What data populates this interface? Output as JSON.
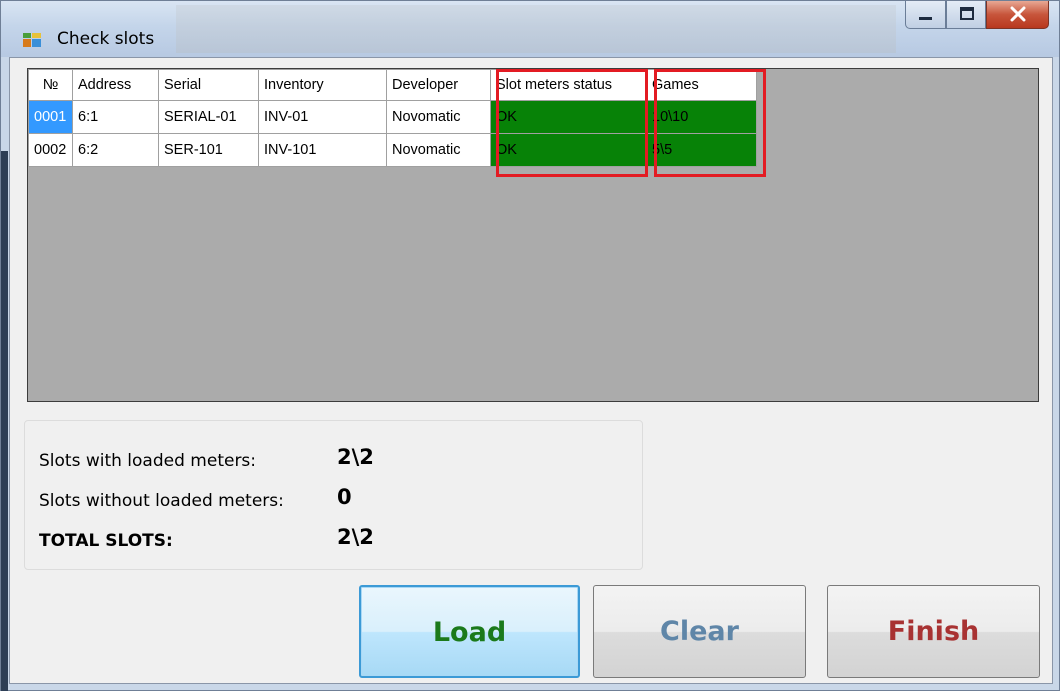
{
  "window": {
    "title": "Check slots",
    "icon": "app-window-icon",
    "controls": {
      "minimize": "minimize-icon",
      "maximize": "maximize-icon",
      "close": "close-icon"
    }
  },
  "grid": {
    "columns": [
      "№",
      "Address",
      "Serial",
      "Inventory",
      "Developer",
      "Slot meters status",
      "Games"
    ],
    "rows": [
      {
        "num": "0001",
        "address": "6:1",
        "serial": "SERIAL-01",
        "inventory": "INV-01",
        "developer": "Novomatic",
        "status": "OK",
        "games": "10\\10"
      },
      {
        "num": "0002",
        "address": "6:2",
        "serial": "SER-101",
        "inventory": "INV-101",
        "developer": "Novomatic",
        "status": "OK",
        "games": "5\\5"
      }
    ],
    "colors": {
      "ok_cell": "#078207",
      "selected": "#3399ff",
      "highlight": "#e31b23",
      "empty_area": "#ababab"
    }
  },
  "summary": {
    "loaded_label": "Slots with loaded meters:",
    "loaded_value": "2\\2",
    "not_loaded_label": "Slots without loaded meters:",
    "not_loaded_value": "0",
    "total_label": "TOTAL SLOTS:",
    "total_value": "2\\2"
  },
  "buttons": {
    "load": {
      "label": "Load",
      "color": "#1b7a1b"
    },
    "clear": {
      "label": "Clear",
      "color": "#5f86a8"
    },
    "finish": {
      "label": "Finish",
      "color": "#a83232"
    }
  }
}
